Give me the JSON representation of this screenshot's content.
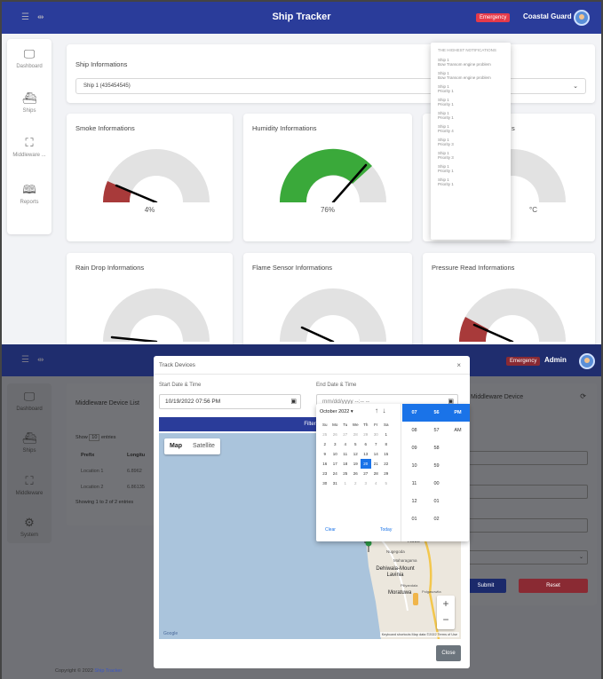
{
  "top": {
    "header": {
      "title": "Ship Tracker",
      "emergency": "Emergency",
      "user": "Coastal Guard"
    },
    "sidebar": [
      {
        "icon": "monitor-icon",
        "label": "Dashboard"
      },
      {
        "icon": "ship-icon",
        "label": "Ships"
      },
      {
        "icon": "network-icon",
        "label": "Middleware ..."
      },
      {
        "icon": "book-icon",
        "label": "Reports"
      }
    ],
    "ship_info": {
      "heading": "Ship Informations",
      "selected": "Ship 1 (435454545)"
    },
    "gauges": [
      {
        "title": "Smoke Informations",
        "value": 4,
        "label": "4%"
      },
      {
        "title": "Humidity Informations",
        "value": 76,
        "label": "76%"
      },
      {
        "title": "Rain Drop Informations"
      },
      {
        "title": "Flame Sensor Informations"
      },
      {
        "title": "Pressure Read Informations"
      }
    ],
    "third_gauge_tail": {
      "title_tail": "s",
      "label_tail": "°C"
    },
    "notifications": {
      "header": "THE HIGHEST NOTIFICATIONS",
      "items": [
        [
          "Ship 1",
          "Bow Transom engine problem"
        ],
        [
          "Ship 1",
          "Bow Transom engine problem"
        ],
        [
          "Ship 1",
          "Priority 1"
        ],
        [
          "Ship 1",
          "Priority 1"
        ],
        [
          "Ship 1",
          "Priority 1"
        ],
        [
          "Ship 1",
          "Priority 4"
        ],
        [
          "Ship 1",
          "Priority 3"
        ],
        [
          "Ship 1",
          "Priority 3"
        ],
        [
          "Ship 1",
          "Priority 1"
        ],
        [
          "Ship 1",
          "Priority 1"
        ]
      ]
    }
  },
  "bottom": {
    "header": {
      "title": "Ship Tracker",
      "emergency": "Emergency",
      "user": "Admin"
    },
    "sidebar": [
      {
        "icon": "monitor-icon",
        "label": "Dashboard"
      },
      {
        "icon": "ship-icon",
        "label": "Ships"
      },
      {
        "icon": "network-icon",
        "label": "Middleware"
      },
      {
        "icon": "gear-icon",
        "label": "System"
      }
    ],
    "device_list": {
      "title": "Middleware Device List",
      "show_prefix": "Show",
      "show_value": "10",
      "show_suffix": "entries",
      "columns": [
        "Prefix",
        "Longitu"
      ],
      "rows": [
        [
          "Location 1",
          "6.8962"
        ],
        [
          "Location 2",
          "6.86135"
        ]
      ],
      "info": "Showing 1 to 2 of 2 entries"
    },
    "right_panel": {
      "title": "Middleware Device",
      "submit": "Submit",
      "reset": "Reset"
    },
    "modal": {
      "title": "Track Devices",
      "start_label": "Start Date & Time",
      "start_value": "10/19/2022 07:56 PM",
      "end_label": "End Date & Time",
      "end_value": "mm/dd/yyyy --:-- --",
      "filter": "Filter",
      "map_tabs": [
        "Map",
        "Satellite"
      ],
      "close": "Close",
      "map_labels": [
        "Sri Jayawardenepura Kotte",
        "Nugegoda",
        "Maharagama",
        "Dehiwala-Mount Lavinia",
        "Moratuwa",
        "Piliyandala",
        "Polgasowita",
        "Malabe"
      ],
      "map_footer": "Keyboard shortcuts   Map data ©2022   Terms of Use",
      "google": "Google"
    },
    "calendar": {
      "month": "October 2022 ▾",
      "weekdays": [
        "Su",
        "Mo",
        "Tu",
        "We",
        "Th",
        "Fr",
        "Sa"
      ],
      "weeks": [
        [
          "25",
          "26",
          "27",
          "28",
          "29",
          "30",
          "1"
        ],
        [
          "2",
          "3",
          "4",
          "5",
          "6",
          "7",
          "8"
        ],
        [
          "9",
          "10",
          "11",
          "12",
          "13",
          "14",
          "15"
        ],
        [
          "16",
          "17",
          "18",
          "19",
          "20",
          "21",
          "22"
        ],
        [
          "23",
          "24",
          "25",
          "26",
          "27",
          "28",
          "29"
        ],
        [
          "30",
          "31",
          "1",
          "2",
          "3",
          "4",
          "5"
        ]
      ],
      "selected_day": "20",
      "clear": "Clear",
      "today": "Today",
      "hours": [
        "07",
        "08",
        "09",
        "10",
        "11",
        "12",
        "01"
      ],
      "minutes": [
        "56",
        "57",
        "58",
        "59",
        "00",
        "01",
        "02"
      ],
      "ampm": [
        "PM",
        "AM"
      ]
    },
    "footer": {
      "prefix": "Copyright © 2022 ",
      "brand": "Ship Tracker"
    }
  }
}
